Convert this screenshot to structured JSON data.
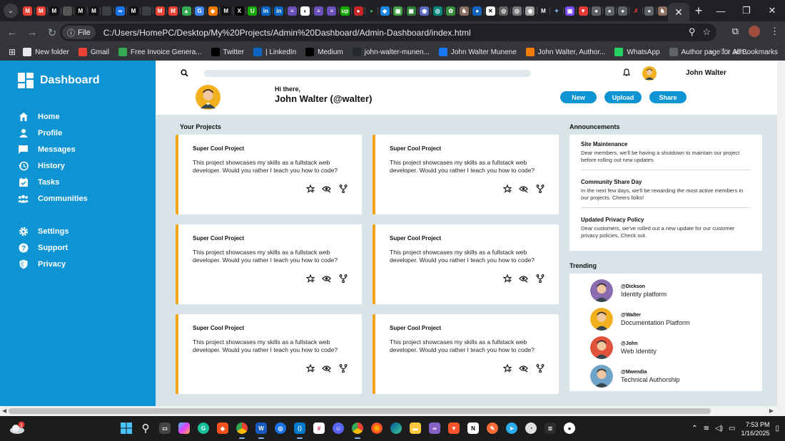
{
  "browser": {
    "active_tab_icon": "chrome-tab-icon",
    "url_scheme_label": "File",
    "url": "C:/Users/HomePC/Desktop/My%20Projects/Admin%20Dashboard/Admin-Dashboard/index.html",
    "bookmarks": [
      {
        "label": "New folder",
        "icon": "folder-icon",
        "color": "#e8eaed"
      },
      {
        "label": "Gmail",
        "icon": "gmail-icon",
        "color": "#ea4335"
      },
      {
        "label": "Free Invoice Genera...",
        "icon": "invoice-icon",
        "color": "#34a853"
      },
      {
        "label": "Twitter",
        "icon": "x-icon",
        "color": "#000000"
      },
      {
        "label": "| LinkedIn",
        "icon": "linkedin-icon",
        "color": "#0a66c2"
      },
      {
        "label": "Medium",
        "icon": "medium-icon",
        "color": "#000000"
      },
      {
        "label": "john-walter-munen...",
        "icon": "github-icon",
        "color": "#24292e"
      },
      {
        "label": "John Walter Munene",
        "icon": "facebook-icon",
        "color": "#1877f2"
      },
      {
        "label": "John Walter, Author...",
        "icon": "author-icon",
        "color": "#f57c00"
      },
      {
        "label": "WhatsApp",
        "icon": "whatsapp-icon",
        "color": "#25d366"
      },
      {
        "label": "Author page for Joh...",
        "icon": "page-icon",
        "color": "#5f6368"
      }
    ],
    "all_bookmarks_label": "All Bookmarks"
  },
  "sidebar": {
    "brand": "Dashboard",
    "items": [
      {
        "label": "Home",
        "icon": "home-icon"
      },
      {
        "label": "Profile",
        "icon": "profile-icon"
      },
      {
        "label": "Messages",
        "icon": "messages-icon"
      },
      {
        "label": "History",
        "icon": "history-icon"
      },
      {
        "label": "Tasks",
        "icon": "tasks-icon"
      },
      {
        "label": "Communities",
        "icon": "communities-icon"
      }
    ],
    "settings_items": [
      {
        "label": "Settings",
        "icon": "settings-icon"
      },
      {
        "label": "Support",
        "icon": "support-icon"
      },
      {
        "label": "Privacy",
        "icon": "privacy-icon"
      }
    ]
  },
  "header": {
    "user_name": "John Walter",
    "greeting_small": "Hi there,",
    "greeting_big": "John Walter (@walter)",
    "buttons": {
      "new": "New",
      "upload": "Upload",
      "share": "Share"
    }
  },
  "projects": {
    "title": "Your Projects",
    "cards": [
      {
        "title": "Super Cool Project",
        "description": "This project showcases my skills as a fullstack web developer. Would you rather I teach you how to code?"
      },
      {
        "title": "Super Cool Project",
        "description": "This project showcases my skills as a fullstack web developer. Would you rather I teach you how to code?"
      },
      {
        "title": "Super Cool Project",
        "description": "This project showcases my skills as a fullstack web developer. Would you rather I teach you how to code?"
      },
      {
        "title": "Super Cool Project",
        "description": "This project showcases my skills as a fullstack web developer. Would you rather I teach you how to code?"
      },
      {
        "title": "Super Cool Project",
        "description": "This project showcases my skills as a fullstack web developer. Would you rather I teach you how to code?"
      },
      {
        "title": "Super Cool Project",
        "description": "This project showcases my skills as a fullstack web developer. Would you rather I teach you how to code?"
      }
    ]
  },
  "announcements": {
    "title": "Announcements",
    "items": [
      {
        "title": "Site Maintenance",
        "body": "Dear members, we'll be having a shutdown to maintain our project before rolling out new updates"
      },
      {
        "title": "Community Share Day",
        "body": "In the next few days, we'll be rewarding the most active members in our projects. Cheers folks!"
      },
      {
        "title": "Updated Privacy Policy",
        "body": "Dear customers, we've rolled out a new update for our customer privacy policies. Check out."
      }
    ]
  },
  "trending": {
    "title": "Trending",
    "items": [
      {
        "handle": "@Dickson",
        "name": "Identity platform",
        "avatar_bg": "#8b6bb0"
      },
      {
        "handle": "@Walter",
        "name": "Documentation Platform",
        "avatar_bg": "#f2b01e"
      },
      {
        "handle": "@John",
        "name": "Web Identity",
        "avatar_bg": "#e0533a"
      },
      {
        "handle": "@Mwendia",
        "name": "Technical Authorship",
        "avatar_bg": "#6fa3c7"
      }
    ]
  },
  "taskbar": {
    "time": "7:53 PM",
    "date": "1/16/2025",
    "weather_badge": "1"
  },
  "colors": {
    "accent": "#0e93d3",
    "card_border": "#f4a51c",
    "page_bg": "#d9e4e8"
  }
}
